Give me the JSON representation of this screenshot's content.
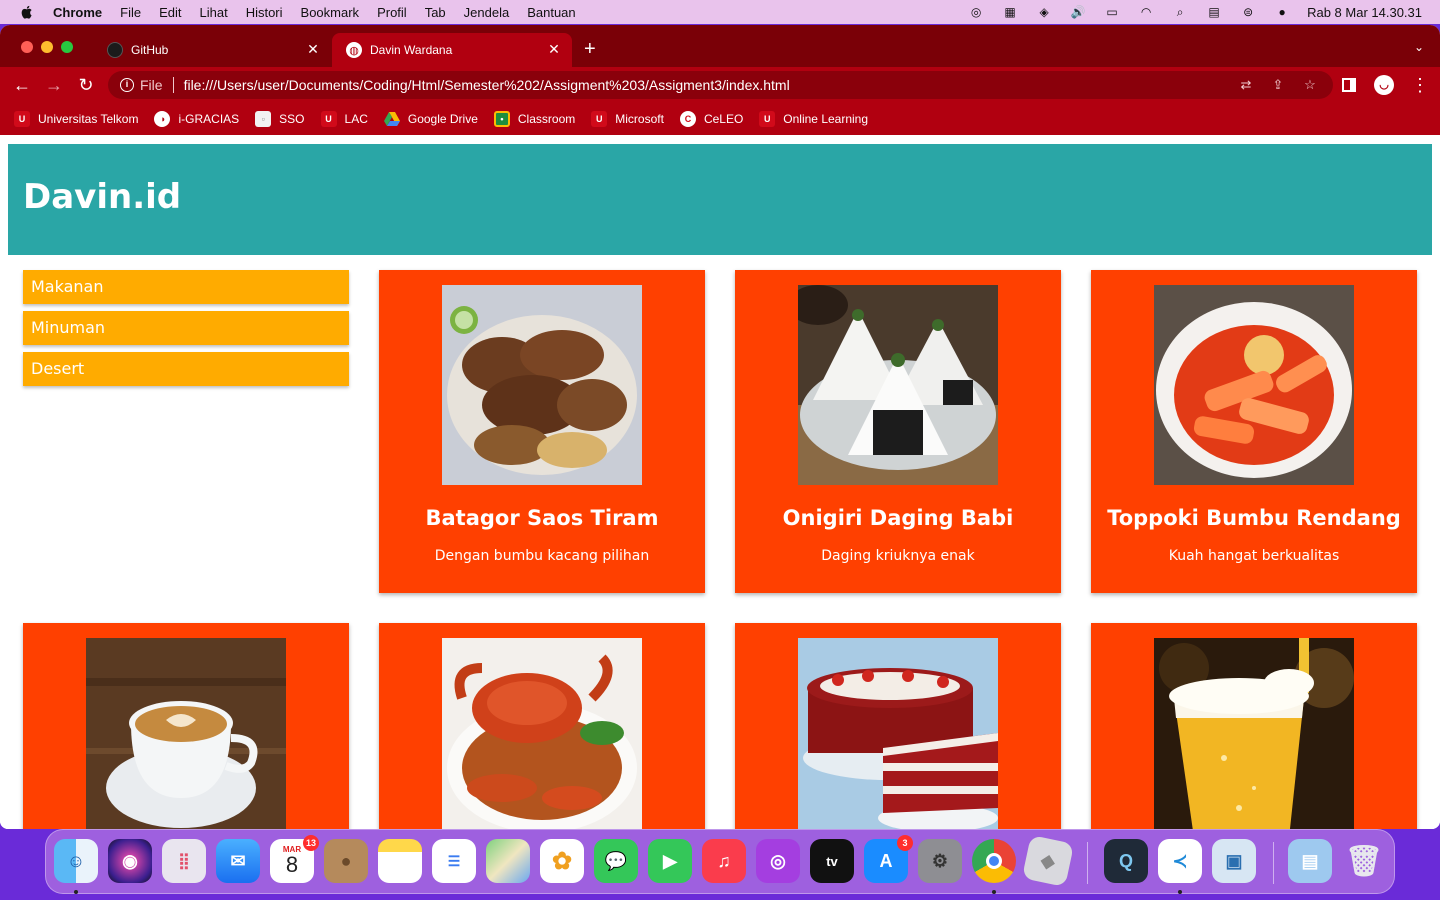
{
  "menubar": {
    "app": "Chrome",
    "items": [
      "File",
      "Edit",
      "Lihat",
      "Histori",
      "Bookmark",
      "Profil",
      "Tab",
      "Jendela",
      "Bantuan"
    ],
    "clock": "Rab 8 Mar  14.30.31"
  },
  "browser": {
    "tabs": [
      {
        "title": "GitHub",
        "active": false
      },
      {
        "title": "Davin Wardana",
        "active": true
      }
    ],
    "address": {
      "scheme": "File",
      "url": "file:///Users/user/Documents/Coding/Html/Semester%202/Assigment%203/Assigment3/index.html"
    },
    "bookmarks": [
      "Universitas Telkom",
      "i-GRACIAS",
      "SSO",
      "LAC",
      "Google Drive",
      "Classroom",
      "Microsoft",
      "CeLEO",
      "Online Learning"
    ]
  },
  "site": {
    "title": "Davin.id",
    "menu": [
      "Makanan",
      "Minuman",
      "Desert"
    ],
    "cards": [
      {
        "title": "Batagor Saos Tiram",
        "desc": "Dengan bumbu kacang pilihan",
        "image": "batagor-photo"
      },
      {
        "title": "Onigiri Daging Babi",
        "desc": "Daging kriuknya enak",
        "image": "onigiri-photo"
      },
      {
        "title": "Toppoki Bumbu Rendang",
        "desc": "Kuah hangat berkualitas",
        "image": "toppoki-photo"
      },
      {
        "title": "",
        "desc": "",
        "image": "coffee-photo"
      },
      {
        "title": "",
        "desc": "",
        "image": "crab-photo"
      },
      {
        "title": "",
        "desc": "",
        "image": "red-velvet-cake-photo"
      },
      {
        "title": "",
        "desc": "",
        "image": "beer-photo"
      }
    ]
  },
  "dock": {
    "calendar": {
      "month": "MAR",
      "day": "8",
      "badge": "13"
    },
    "appstore_badge": "3",
    "apps": [
      "Finder",
      "Siri",
      "Launchpad",
      "Mail",
      "Calendar",
      "Contacts",
      "Notes",
      "Reminders",
      "Maps",
      "Photos",
      "Messages",
      "FaceTime",
      "Music",
      "Podcasts",
      "TV",
      "App Store",
      "System Preferences",
      "Chrome",
      "Roblox",
      "QuickTime",
      "VS Code",
      "Preview",
      "Downloads",
      "Trash"
    ]
  },
  "colors": {
    "header": "#2aa6a6",
    "menu": "#ffab00",
    "card": "#ff4000",
    "chrome_frame": "#b10010"
  }
}
